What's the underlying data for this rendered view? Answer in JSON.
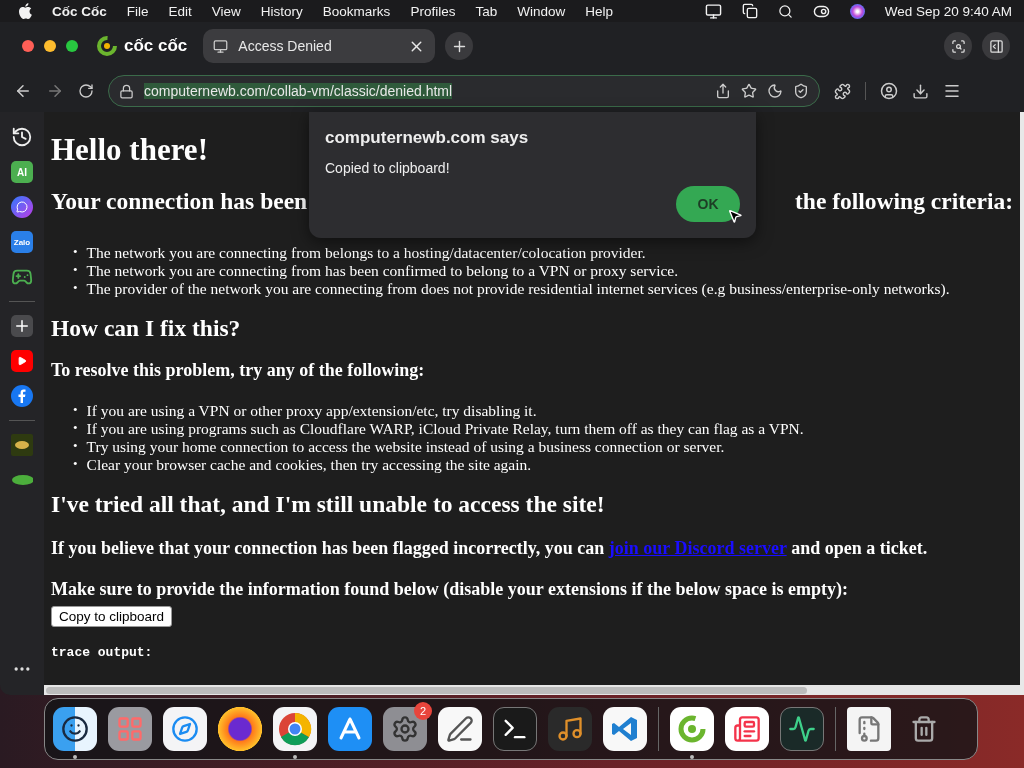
{
  "menu_bar": {
    "app_name": "Cốc Cốc",
    "items": [
      "File",
      "Edit",
      "View",
      "History",
      "Bookmarks",
      "Profiles",
      "Tab",
      "Window",
      "Help"
    ],
    "clock": "Wed Sep 20  9:40 AM"
  },
  "browser": {
    "brand": "cốc cốc",
    "tabs": [
      {
        "title": "Access Denied",
        "selected": true
      }
    ],
    "url": "computernewb.com/collab-vm/classic/denied.html"
  },
  "sidebar": [
    {
      "kind": "history"
    },
    {
      "kind": "ai",
      "label": "AI"
    },
    {
      "kind": "messenger"
    },
    {
      "kind": "zalo",
      "label": "Zalo"
    },
    {
      "kind": "game"
    },
    {
      "kind": "divider"
    },
    {
      "kind": "add"
    },
    {
      "kind": "youtube"
    },
    {
      "kind": "facebook"
    },
    {
      "kind": "divider"
    },
    {
      "kind": "sro"
    },
    {
      "kind": "wacoo"
    },
    {
      "kind": "more"
    }
  ],
  "page": {
    "title": "Hello there!",
    "bullet": "•",
    "heading_parts": [
      "Your connection has been",
      "the following criteria:"
    ],
    "criteria": [
      "The network you are connecting from belongs to a hosting/datacenter/colocation provider.",
      "The network you are connecting from has been confirmed to belong to a VPN or proxy service.",
      "The provider of the network you are connecting from does not provide residential internet services (e.g business/enterprise-only networks)."
    ],
    "fix_heading": "How can I fix this?",
    "fix_intro": "To resolve this problem, try any of the following:",
    "fixes": [
      "If you are using a VPN or other proxy app/extension/etc, try disabling it.",
      "If you are using programs such as Cloudflare WARP, iCloud Private Relay, turn them off as they can flag as a VPN.",
      "Try using your home connection to access the website instead of using a business connection or server.",
      "Clear your browser cache and cookies, then try accessing the site again."
    ],
    "tried_heading": "I've tried all that, and I'm still unable to access the site!",
    "flagged_before": "If you believe that your connection has been flagged incorrectly, you can",
    "flagged_link": "join our Discord server",
    "flagged_after": "and open a ticket.",
    "info": "Make sure to provide the information found below (disable your extensions if the below space is empty):",
    "copy_button": "Copy to clipboard",
    "trace": "trace output:"
  },
  "dialog": {
    "title": "computernewb.com says",
    "message": "Copied to clipboard!",
    "button": "OK"
  },
  "dock": [
    {
      "kind": "finder",
      "running": true
    },
    {
      "kind": "launchpad",
      "running": false
    },
    {
      "kind": "safari",
      "running": false
    },
    {
      "kind": "firefox",
      "running": false
    },
    {
      "kind": "chrome",
      "running": true
    },
    {
      "kind": "appstore",
      "running": false
    },
    {
      "kind": "settings",
      "running": false,
      "badge": "2"
    },
    {
      "kind": "textedit",
      "running": false
    },
    {
      "kind": "terminal",
      "running": false
    },
    {
      "kind": "garageband",
      "running": false
    },
    {
      "kind": "vscode",
      "running": false
    },
    {
      "kind": "divider"
    },
    {
      "kind": "coccoc",
      "running": true
    },
    {
      "kind": "news",
      "running": false
    },
    {
      "kind": "monitor",
      "running": false
    },
    {
      "kind": "divider"
    },
    {
      "kind": "archive",
      "running": false
    },
    {
      "kind": "trash",
      "running": false
    }
  ]
}
